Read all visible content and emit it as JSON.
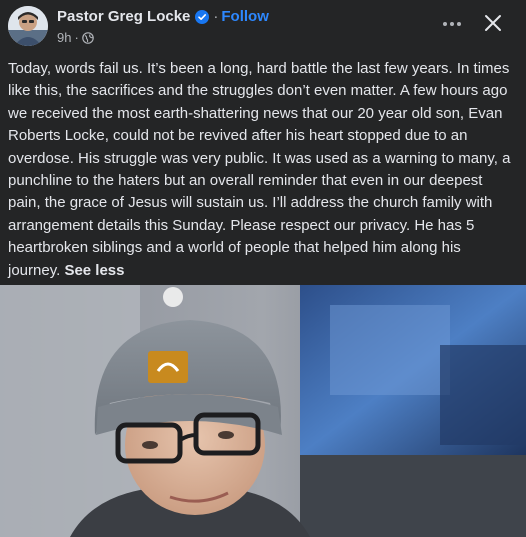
{
  "post": {
    "author": "Pastor Greg Locke",
    "follow_label": "Follow",
    "separator": "·",
    "time": "9h",
    "text": "Today, words fail us. It’s been a long, hard battle the last few years. In times like this, the sacrifices and the struggles don’t even matter. A few hours ago we received the most earth-shattering news that our 20 year old son, Evan Roberts Locke, could not be revived after his heart stopped due to an overdose. His struggle was very public. It was used as a warning to many, a punchline to the haters but an overall reminder that even in our deepest pain, the grace of Jesus will sustain us. I’ll address the church family with arrangement details this Sunday. Please respect our privacy. He has 5 heartbroken siblings and a world of people that helped him along his journey.",
    "see_less_label": "See less"
  },
  "icons": {
    "verified": "verified-badge-icon",
    "audience": "globe-icon",
    "more": "more-options-icon",
    "close": "close-icon"
  },
  "colors": {
    "background": "#242526",
    "text": "#e4e6eb",
    "secondary_text": "#b0b3b8",
    "link_blue": "#2d88ff",
    "verified_blue": "#1877f2"
  }
}
